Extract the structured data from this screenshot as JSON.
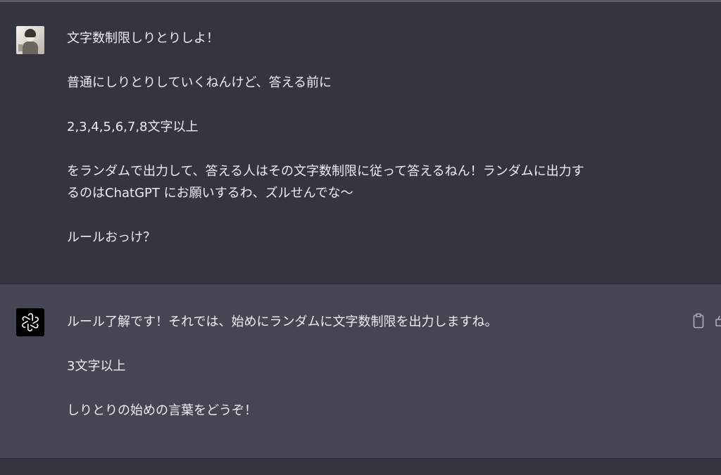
{
  "conversation": {
    "user_message": {
      "paragraphs": [
        "文字数制限しりとりしよ！",
        "普通にしりとりしていくねんけど、答える前に",
        "2,3,4,5,6,7,8文字以上",
        "をランダムで出力して、答える人はその文字数制限に従って答えるねん！ランダムに出力す\nるのはChatGPT にお願いするわ、ズルせんでな〜",
        "ルールおっけ？"
      ]
    },
    "assistant_message": {
      "paragraphs": [
        "ルール了解です！それでは、始めにランダムに文字数制限を出力しますね。",
        "3文字以上",
        "しりとりの始めの言葉をどうぞ！"
      ]
    }
  },
  "icons": {
    "user_avatar": "user-avatar",
    "assistant_avatar": "openai-logo-icon",
    "copy": "clipboard-icon",
    "feedback": "thumbs-up-icon"
  },
  "colors": {
    "user_bg": "#343541",
    "assistant_bg": "#444654",
    "text": "#ececf1",
    "icon": "#acacbe"
  }
}
